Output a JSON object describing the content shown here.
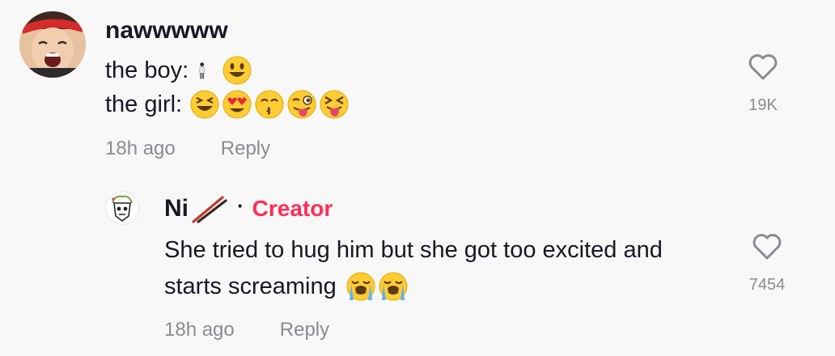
{
  "comment": {
    "username": "nawwwww",
    "line1_text": "the boy:",
    "line1_emojis": [
      "person-standing-emoji",
      "smiling-face-emoji"
    ],
    "line2_text": "the girl:",
    "line2_emojis": [
      "laughing-squint-emoji",
      "heart-eyes-emoji",
      "kissing-smile-eyes-emoji",
      "winking-tongue-emoji",
      "squinting-tongue-emoji"
    ],
    "timestamp": "18h ago",
    "reply_label": "Reply",
    "like_count": "19K"
  },
  "reply": {
    "username": "Ni",
    "username_emoji": "chopsticks-emoji",
    "separator": "·",
    "badge": "Creator",
    "line1_text": "She tried to hug him but she got too excited and",
    "line2_text": "starts screaming",
    "line2_emojis": [
      "loudly-crying-emoji",
      "loudly-crying-emoji"
    ],
    "timestamp": "18h ago",
    "reply_label": "Reply",
    "like_count": "7454"
  },
  "colors": {
    "background": "#f8f8f8",
    "text": "#161823",
    "muted": "#8a8b91",
    "creator_accent": "#fe2c55"
  }
}
